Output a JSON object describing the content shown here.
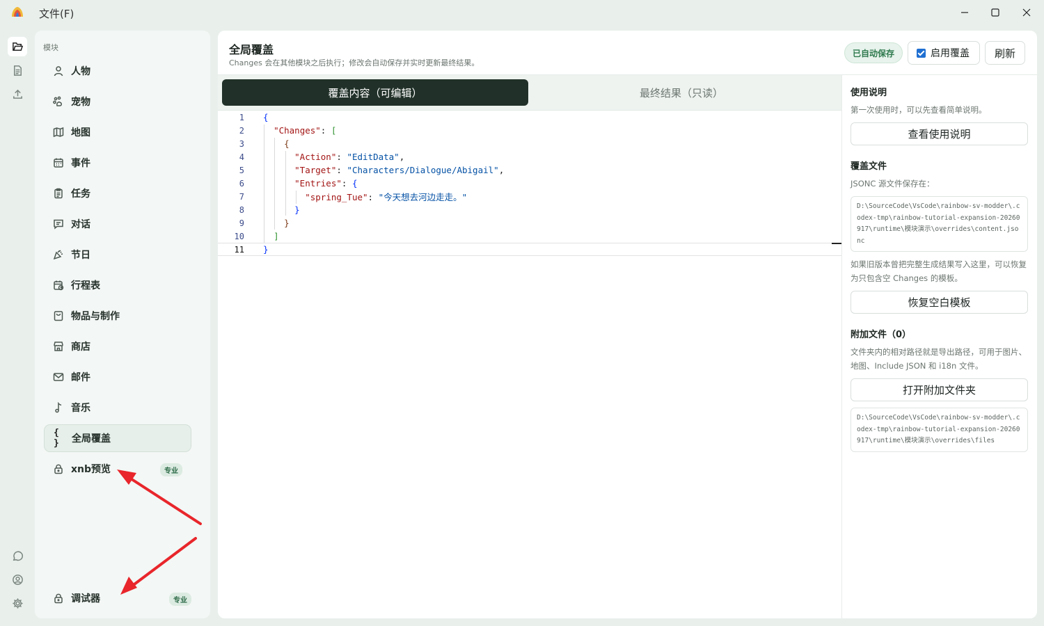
{
  "titlebar": {
    "menu_file": "文件(F)",
    "minimize": "—",
    "maximize": "☐",
    "close": "✕"
  },
  "sidebar": {
    "section_label": "模块",
    "items": [
      {
        "label": "人物",
        "icon": "person-icon"
      },
      {
        "label": "宠物",
        "icon": "paw-icon"
      },
      {
        "label": "地图",
        "icon": "map-icon"
      },
      {
        "label": "事件",
        "icon": "calendar-icon"
      },
      {
        "label": "任务",
        "icon": "clipboard-icon"
      },
      {
        "label": "对话",
        "icon": "chat-icon"
      },
      {
        "label": "节日",
        "icon": "party-icon"
      },
      {
        "label": "行程表",
        "icon": "schedule-icon"
      },
      {
        "label": "物品与制作",
        "icon": "bag-icon"
      },
      {
        "label": "商店",
        "icon": "store-icon"
      },
      {
        "label": "邮件",
        "icon": "mail-icon"
      },
      {
        "label": "音乐",
        "icon": "music-icon"
      },
      {
        "label": "全局覆盖",
        "icon": "braces-icon"
      },
      {
        "label": "xnb预览",
        "icon": "lock-icon",
        "badge": "专业"
      },
      {
        "label": "调试器",
        "icon": "lock-icon",
        "badge": "专业"
      }
    ]
  },
  "header": {
    "title": "全局覆盖",
    "subtitle": "Changes 会在其他模块之后执行；修改会自动保存并实时更新最终结果。",
    "saved_badge": "已自动保存",
    "enable_label": "启用覆盖",
    "enable_checked": true,
    "refresh": "刷新"
  },
  "tabs": {
    "edit": "覆盖内容（可编辑）",
    "result": "最终结果（只读）"
  },
  "editor": {
    "line_numbers": [
      "1",
      "2",
      "3",
      "4",
      "5",
      "6",
      "7",
      "8",
      "9",
      "10",
      "11"
    ],
    "key_changes": "\"Changes\"",
    "key_action": "\"Action\"",
    "val_action": "\"EditData\"",
    "key_target": "\"Target\"",
    "val_target": "\"Characters/Dialogue/Abigail\"",
    "key_entries": "\"Entries\"",
    "key_spring": "\"spring_Tue\"",
    "val_spring": "\"今天想去河边走走。\""
  },
  "info": {
    "usage_title": "使用说明",
    "usage_text": "第一次使用时，可以先查看简单说明。",
    "usage_btn": "查看使用说明",
    "file_title": "覆盖文件",
    "file_text": "JSONC 源文件保存在：",
    "file_path": "D:\\SourceCode\\VsCode\\rainbow-sv-modder\\.codex-tmp\\rainbow-tutorial-expansion-20260917\\runtime\\模块演示\\overrides\\content.jsonc",
    "restore_text": "如果旧版本曾把完整生成结果写入这里，可以恢复为只包含空 Changes 的模板。",
    "restore_btn": "恢复空白模板",
    "attach_title": "附加文件（0）",
    "attach_text": "文件夹内的相对路径就是导出路径，可用于图片、地图、Include JSON 和 i18n 文件。",
    "attach_btn": "打开附加文件夹",
    "attach_path": "D:\\SourceCode\\VsCode\\rainbow-sv-modder\\.codex-tmp\\rainbow-tutorial-expansion-20260917\\runtime\\模块演示\\overrides\\files"
  }
}
